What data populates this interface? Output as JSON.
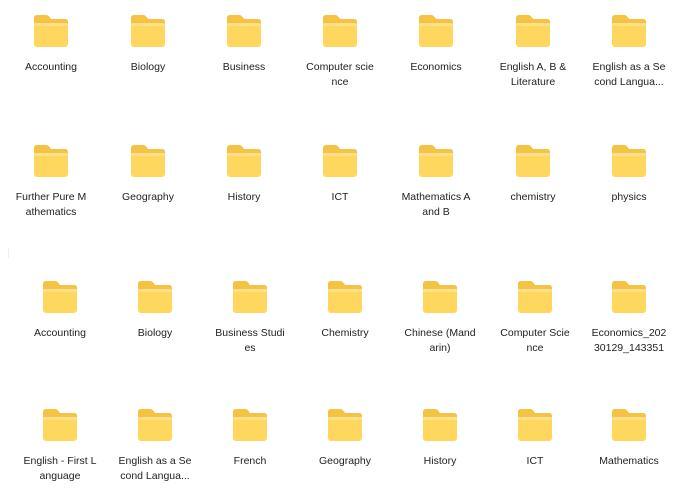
{
  "colors": {
    "folder_back": "#F5C342",
    "folder_front": "#FFD75E",
    "folder_front_light": "#FFE08A",
    "label": "#222222"
  },
  "icon": "folder-icon",
  "section1": {
    "rows": [
      [
        {
          "label": "Accounting"
        },
        {
          "label": "Biology"
        },
        {
          "label": "Business"
        },
        {
          "label": "Computer scie\nnce"
        },
        {
          "label": "Economics"
        },
        {
          "label": "English A, B &\nLiterature"
        },
        {
          "label": "English as a Se\ncond Langua..."
        }
      ],
      [
        {
          "label": "Further Pure M\nathematics"
        },
        {
          "label": "Geography"
        },
        {
          "label": "History"
        },
        {
          "label": "ICT"
        },
        {
          "label": "Mathematics A\nand B"
        },
        {
          "label": "chemistry"
        },
        {
          "label": "physics"
        }
      ]
    ]
  },
  "section2": {
    "rows": [
      [
        {
          "label": "Accounting"
        },
        {
          "label": "Biology"
        },
        {
          "label": "Business Studi\nes"
        },
        {
          "label": "Chemistry"
        },
        {
          "label": "Chinese (Mand\narin)"
        },
        {
          "label": "Computer Scie\nnce"
        },
        {
          "label": "Economics_202\n30129_143351"
        }
      ],
      [
        {
          "label": "English - First L\nanguage"
        },
        {
          "label": "English as a Se\ncond Langua..."
        },
        {
          "label": "French"
        },
        {
          "label": "Geography"
        },
        {
          "label": "History"
        },
        {
          "label": "ICT"
        },
        {
          "label": "Mathematics"
        }
      ]
    ]
  }
}
